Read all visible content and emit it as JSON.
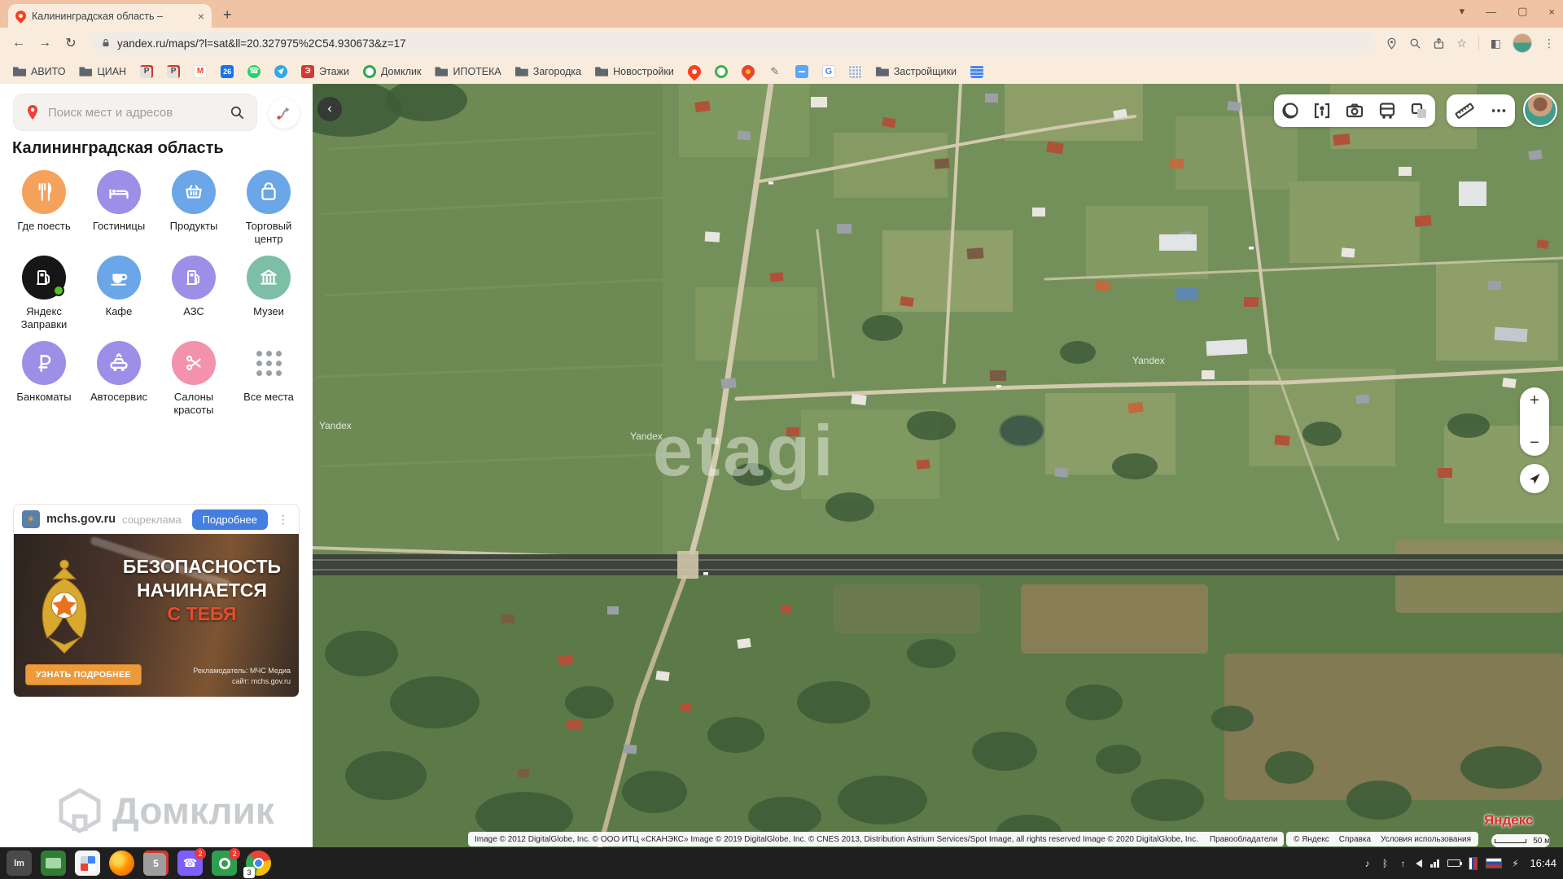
{
  "colors": {
    "chrome_tabstrip": "#efc3a3",
    "chrome_toolbar": "#f9ecdd",
    "yandex_red": "#fc3f1d",
    "accent_blue": "#437ee0",
    "cta_orange": "#ed9a3c",
    "banner_red": "#e84b2c",
    "category_orange": "#f5a25d",
    "category_purple": "#9d8fe8",
    "category_blue": "#6aa6e8",
    "category_teal": "#7cbfa6",
    "category_pink": "#f292ac",
    "taskbar": "#1f1f1f"
  },
  "browser": {
    "tab": {
      "title": "Калининградская область –",
      "close": "×"
    },
    "new_tab": "+",
    "window": {
      "tabs_search": "▾",
      "minimize": "—",
      "maximize": "▢",
      "close": "×"
    },
    "nav": {
      "back": "←",
      "forward": "→",
      "reload": "↻"
    },
    "address": {
      "url": "yandex.ru/maps/?l=sat&ll=20.327975%2C54.930673&z=17"
    },
    "actions": {
      "star": "☆",
      "extensions_square": "◧",
      "kebab": "⋮"
    },
    "bookmarks": [
      {
        "type": "folder",
        "label": "АВИТО"
      },
      {
        "type": "folder",
        "label": "ЦИАН"
      },
      {
        "type": "p",
        "glyph": "P"
      },
      {
        "type": "p",
        "glyph": "P"
      },
      {
        "type": "gmail",
        "glyph": "M"
      },
      {
        "type": "calendar",
        "glyph": "26"
      },
      {
        "type": "whatsapp",
        "glyph": "☎"
      },
      {
        "type": "telegram"
      },
      {
        "type": "etazhi",
        "glyph": "Э",
        "label": "Этажи"
      },
      {
        "type": "domclick",
        "label": "Домклик"
      },
      {
        "type": "folder",
        "label": "ИПОТЕКА"
      },
      {
        "type": "folder",
        "label": "Загородка"
      },
      {
        "type": "folder",
        "label": "Новостройки"
      },
      {
        "type": "ypin"
      },
      {
        "type": "greenring"
      },
      {
        "type": "gpin"
      },
      {
        "type": "pencil",
        "glyph": "✎"
      },
      {
        "type": "chat"
      },
      {
        "type": "translate",
        "glyph": "G"
      },
      {
        "type": "building"
      },
      {
        "type": "folder",
        "label": "Застройщики"
      },
      {
        "type": "bluedoc"
      }
    ]
  },
  "sidebar": {
    "search": {
      "placeholder": "Поиск мест и адресов"
    },
    "region_title": "Калининградская область",
    "categories": [
      {
        "label": "Где поесть"
      },
      {
        "label": "Гостиницы"
      },
      {
        "label": "Продукты"
      },
      {
        "label": "Торговый центр"
      },
      {
        "label": "Яндекс Заправки"
      },
      {
        "label": "Кафе"
      },
      {
        "label": "АЗС"
      },
      {
        "label": "Музеи"
      },
      {
        "label": "Банкоматы"
      },
      {
        "label": "Автосервис"
      },
      {
        "label": "Салоны красоты"
      },
      {
        "label": "Все места"
      }
    ],
    "ad": {
      "site": "mchs.gov.ru",
      "tag": "соцреклама",
      "button": "Подробнее",
      "kebab": "⋮",
      "title_line1": "БЕЗОПАСНОСТЬ",
      "title_line2": "НАЧИНАЕТСЯ",
      "title_line3": "С ТЕБЯ",
      "cta": "УЗНАТЬ ПОДРОБНЕЕ",
      "advertiser": "Рекламодатель: МЧС Медиа",
      "site_note": "сайт: mchs.gov.ru"
    },
    "watermark": "Домклик"
  },
  "map": {
    "collapse": "‹",
    "watermark_yandex": "Yandex",
    "watermark_etagi": "etagi",
    "zoom_in": "+",
    "zoom_out": "−",
    "attribution": "Image © 2012 DigitalGlobe, Inc. © ООО ИТЦ «СКАНЭКС» Image © 2019 DigitalGlobe, Inc. © CNES 2013, Distribution Astrium Services/Spot Image, all rights reserved Image © 2020 DigitalGlobe, Inc.",
    "rights": "Правообладатели",
    "footer_links": [
      "© Яндекс",
      "Справка",
      "Условия использования"
    ],
    "logo": "Яндекс",
    "scale": "50 м"
  },
  "taskbar": {
    "apps": [
      {
        "name": "app-lm",
        "glyph": "lm"
      },
      {
        "name": "app-screen-share"
      },
      {
        "name": "app-grid"
      },
      {
        "name": "firefox"
      },
      {
        "name": "app-docs",
        "glyph": "5"
      },
      {
        "name": "viber",
        "glyph": "☎",
        "badge": "2"
      },
      {
        "name": "app-green",
        "badge": "2"
      },
      {
        "name": "chrome",
        "badge": "3"
      }
    ],
    "tray": [
      {
        "name": "music-note-icon",
        "glyph": "♪"
      },
      {
        "name": "bluetooth-icon",
        "glyph": "ᛒ"
      },
      {
        "name": "upload-icon",
        "glyph": "↑"
      },
      {
        "name": "volume-icon",
        "kind": "volume"
      },
      {
        "name": "network-icon",
        "kind": "bars"
      },
      {
        "name": "battery-icon",
        "kind": "batt"
      },
      {
        "name": "keyboard-flag-icon",
        "kind": "flagv"
      },
      {
        "name": "ru-flag-icon",
        "kind": "flagh"
      },
      {
        "name": "power-icon",
        "glyph": "⚡"
      }
    ],
    "time": "16:44"
  }
}
